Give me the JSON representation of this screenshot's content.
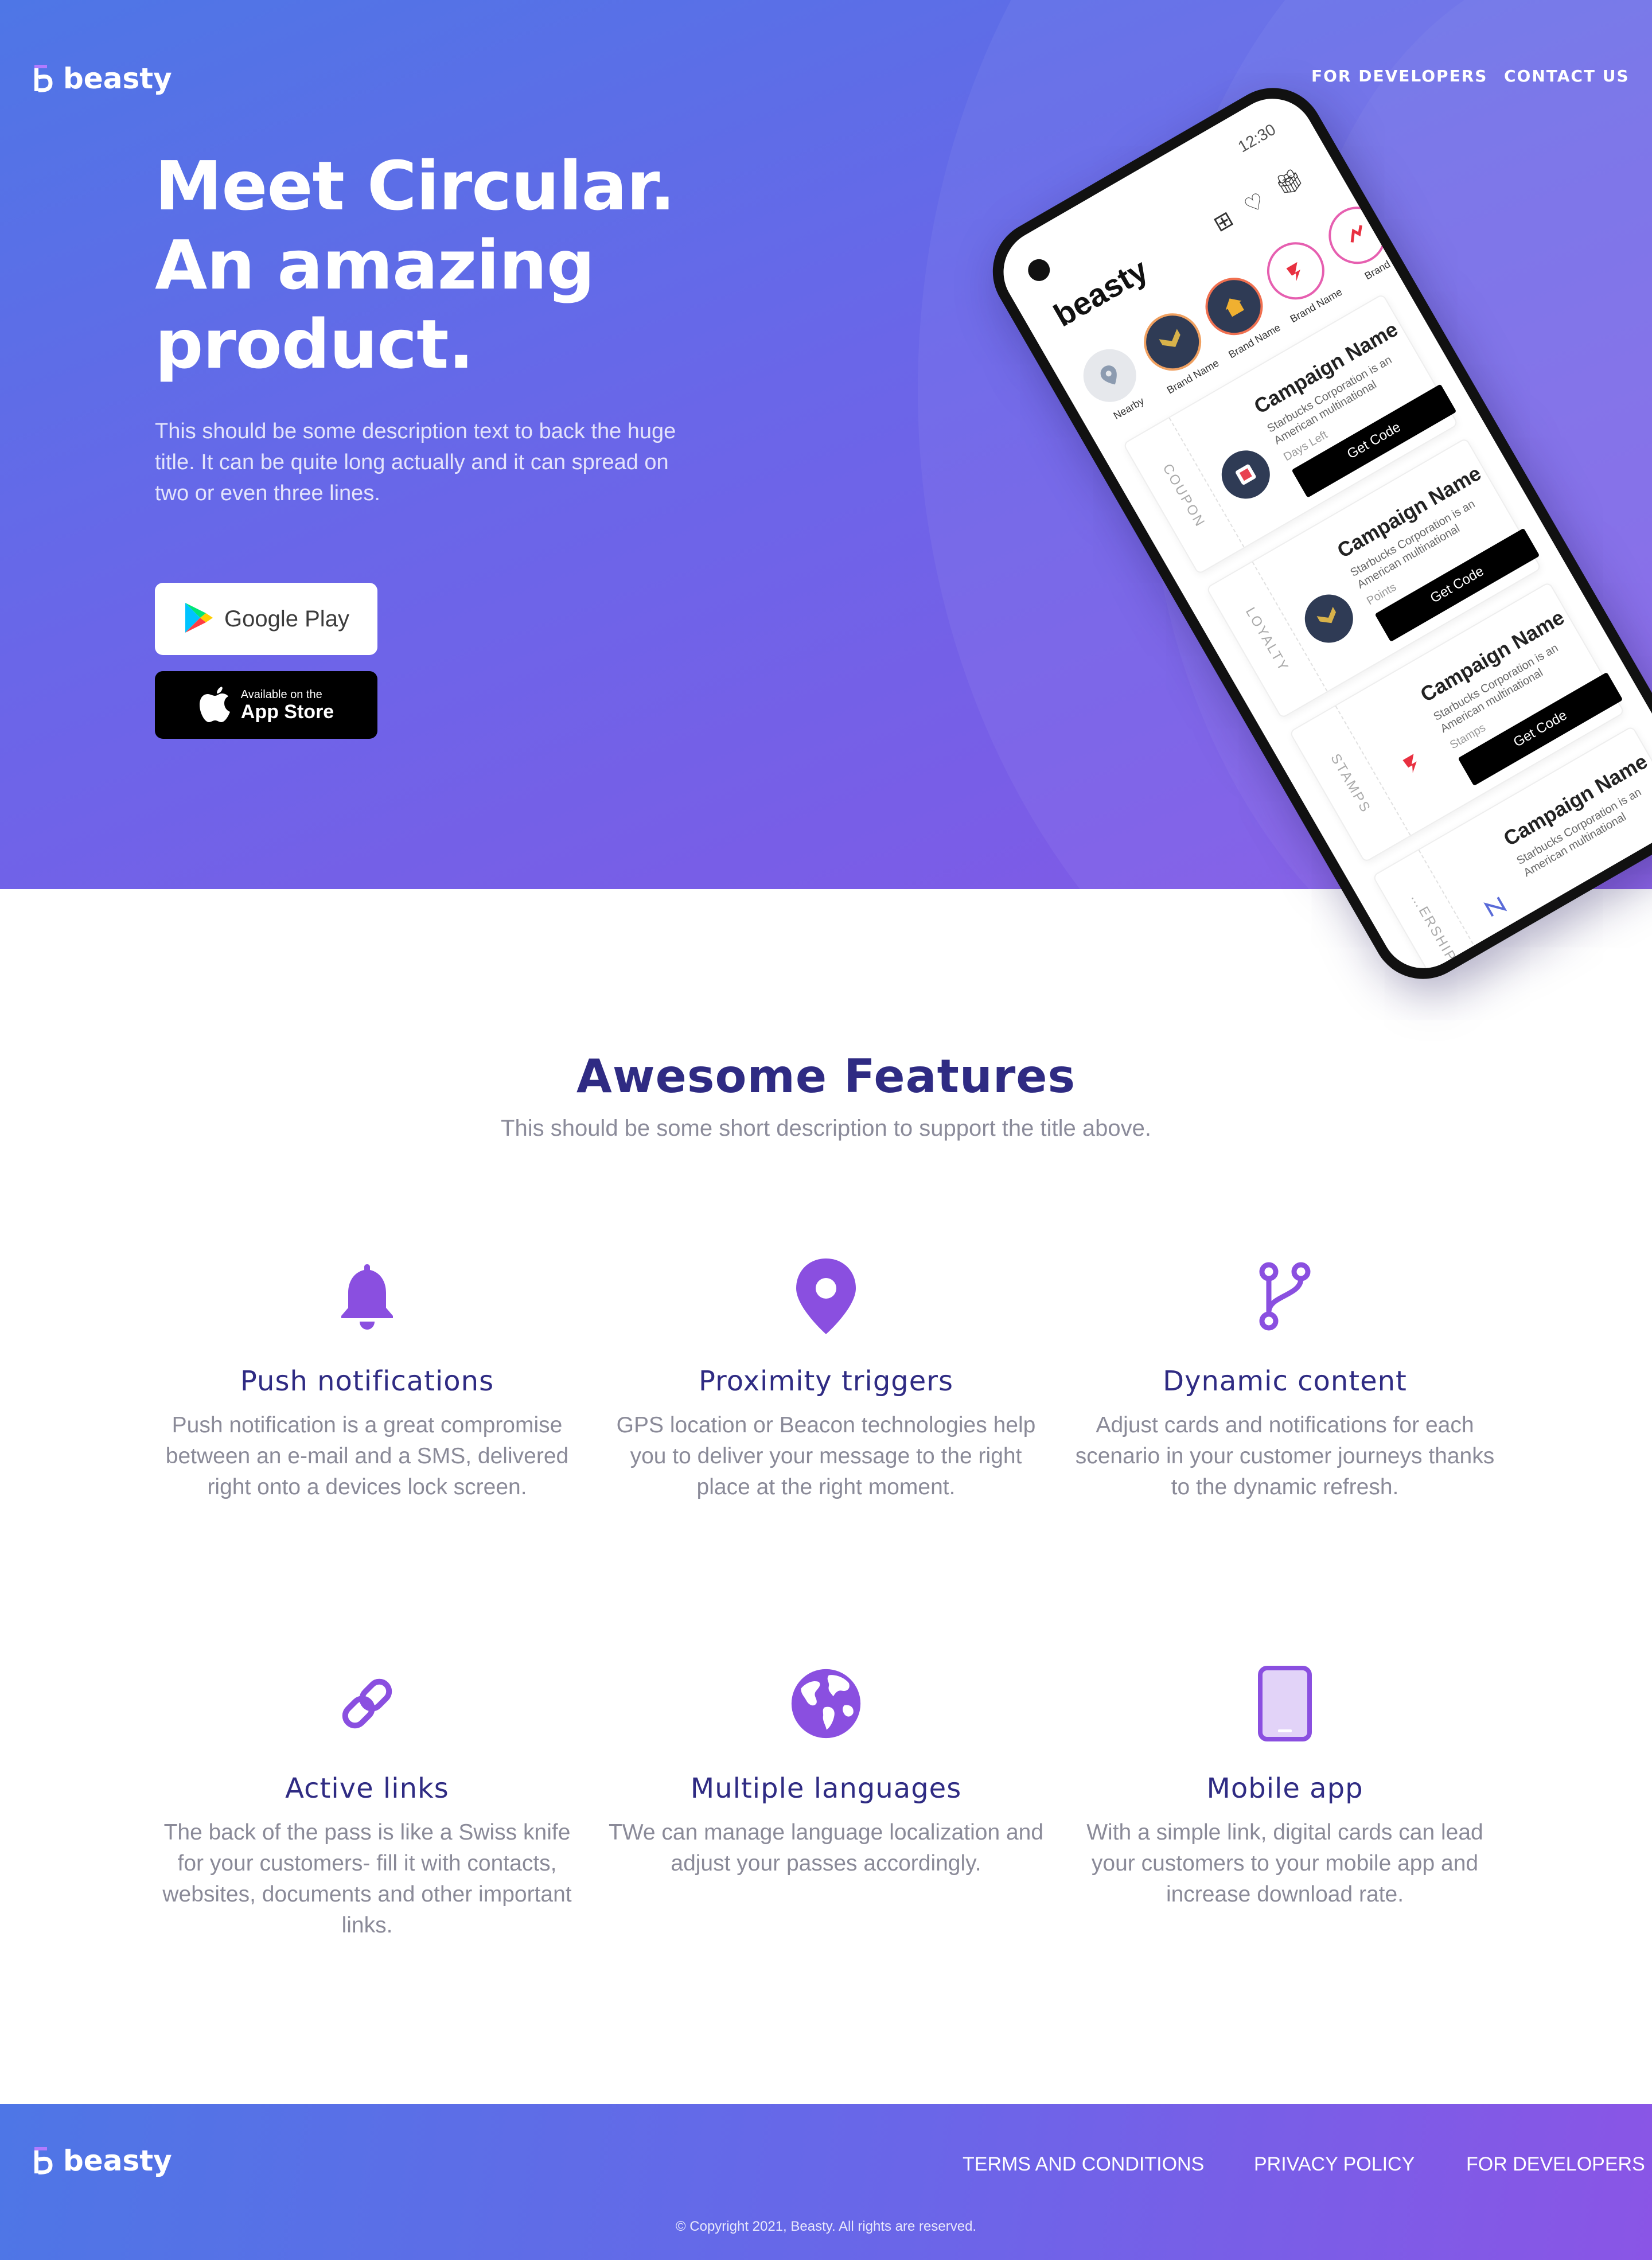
{
  "brand": {
    "name": "beasty"
  },
  "nav": {
    "developers": "FOR DEVELOPERS",
    "contact": "CONTACT US"
  },
  "hero": {
    "title": "Meet Circular.\nAn amazing\nproduct.",
    "description": "This should be some description text to back the huge title. It can be quite long actually and it can spread on two or even three lines.",
    "google_play_label": "Google Play",
    "app_store_small": "Available on the",
    "app_store_big": "App Store"
  },
  "phone": {
    "status_time": "12:30",
    "app_name": "beasty",
    "brands": [
      {
        "label": "Nearby"
      },
      {
        "label": "Brand Name"
      },
      {
        "label": "Brand Name"
      },
      {
        "label": "Brand Name"
      },
      {
        "label": "Brand"
      }
    ],
    "cards": [
      {
        "tag": "COUPON",
        "title": "Campaign Name",
        "subtitle": "Starbucks Corporation is an American multinational",
        "meta": "Days Left",
        "button": "Get Code"
      },
      {
        "tag": "LOYALTY",
        "title": "Campaign Name",
        "subtitle": "Starbucks Corporation is an American multinational",
        "meta": "Points",
        "button": "Get Code"
      },
      {
        "tag": "STAMPS",
        "title": "Campaign Name",
        "subtitle": "Starbucks Corporation is an American multinational",
        "meta": "Stamps",
        "button": "Get Code"
      },
      {
        "tag": "…ERSHIP",
        "title": "Campaign Name",
        "subtitle": "Starbucks Corporation is an American multinational"
      }
    ]
  },
  "features": {
    "title": "Awesome Features",
    "subtitle": "This should be some short description to support the title above.",
    "items": [
      {
        "icon": "bell-icon",
        "title": "Push notifications",
        "text": "Push notification is a great compromise between an e-mail and a SMS, delivered right onto a devices lock screen."
      },
      {
        "icon": "map-pin-icon",
        "title": "Proximity triggers",
        "text": "GPS location or Beacon technologies help you to deliver your message to the right place at the right moment."
      },
      {
        "icon": "branch-icon",
        "title": "Dynamic content",
        "text": "Adjust cards and notifications for each scenario in your customer journeys thanks to the dynamic refresh."
      },
      {
        "icon": "link-icon",
        "title": "Active links",
        "text": "The back of the pass is like a Swiss knife for your customers- fill it with contacts, websites, documents and other important links."
      },
      {
        "icon": "globe-icon",
        "title": "Multiple languages",
        "text": "TWe can manage language localization and adjust your passes accordingly."
      },
      {
        "icon": "tablet-icon",
        "title": "Mobile app",
        "text": "With a simple link, digital cards can lead your customers to your mobile app and increase download rate."
      }
    ]
  },
  "footer": {
    "terms": "TERMS AND CONDITIONS",
    "privacy": "PRIVACY POLICY",
    "developers": "FOR DEVELOPERS",
    "copyright": "© Copyright 2021, Beasty. All rights are reserved."
  },
  "colors": {
    "accent_purple": "#8a4fe0",
    "title_navy": "#2f2b83",
    "hero_gradient_start": "#4e76e6",
    "hero_gradient_end": "#8358e6"
  }
}
